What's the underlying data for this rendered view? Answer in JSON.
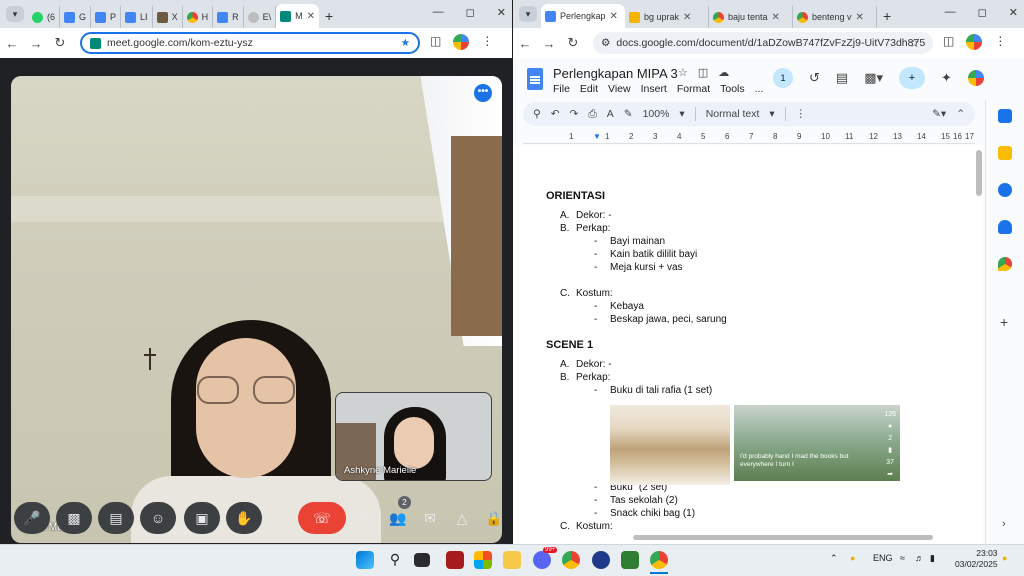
{
  "left_browser": {
    "tabs": [
      {
        "label": "(6",
        "icon": "whatsapp-icon"
      },
      {
        "label": "G",
        "icon": "doc-icon"
      },
      {
        "label": "P",
        "icon": "doc-icon"
      },
      {
        "label": "LI",
        "icon": "doc-icon"
      },
      {
        "label": "X",
        "icon": "image-icon"
      },
      {
        "label": "H",
        "icon": "chrome-icon"
      },
      {
        "label": "R",
        "icon": "doc-icon"
      },
      {
        "label": "E\\",
        "icon": "blank-icon"
      },
      {
        "label": "M",
        "icon": "meet-icon",
        "active": true
      }
    ],
    "url": "meet.google.com/kom-eztu-ysz"
  },
  "meet": {
    "main_participant": "Maria Mulia",
    "pip_participant": "Ashkyne Marielle",
    "participants_badge": "2",
    "more_options": "•••"
  },
  "right_browser": {
    "tabs": [
      {
        "label": "Perlengkap",
        "icon": "doc-icon",
        "active": true
      },
      {
        "label": "bg uprak",
        "icon": "slides-icon"
      },
      {
        "label": "baju tenta",
        "icon": "chrome-icon"
      },
      {
        "label": "benteng v",
        "icon": "chrome-icon"
      }
    ],
    "url": "docs.google.com/document/d/1aDZowB747fZvFzZj9-UitV73dh875..."
  },
  "docs": {
    "title": "Perlengkapan MIPA 3",
    "menu": [
      "File",
      "Edit",
      "View",
      "Insert",
      "Format",
      "Tools",
      "..."
    ],
    "viewers": "1",
    "zoom": "100%",
    "style": "Normal text",
    "ruler": [
      "1",
      "1",
      "2",
      "3",
      "4",
      "5",
      "6",
      "7",
      "8",
      "9",
      "10",
      "11",
      "12",
      "13",
      "14",
      "15",
      "16",
      "17"
    ],
    "orientasi": {
      "heading": "ORIENTASI",
      "a": {
        "marker": "A.",
        "text": "Dekor: -"
      },
      "b": {
        "marker": "B.",
        "text": "Perkap:"
      },
      "b_items": [
        "Bayi mainan",
        "Kain batik dililit bayi",
        "Meja kursi + vas"
      ],
      "c": {
        "marker": "C.",
        "text": "Kostum:"
      },
      "c_items": [
        "Kebaya",
        "Beskap jawa, peci, sarung"
      ]
    },
    "scene1": {
      "heading": "SCENE 1",
      "a": {
        "marker": "A.",
        "text": "Dekor: -"
      },
      "b": {
        "marker": "B.",
        "text": "Perkap:"
      },
      "b_item_first": "Buku di tali rafia (1 set)",
      "b_items_rest": [
        "Buku” (2 set)",
        "Tas sekolah (2)",
        "Snack chiki bag (1)"
      ],
      "c": {
        "marker": "C.",
        "text": "Kostum:"
      }
    },
    "image2_caption": "I'd probably hand I mad the books but everywhere I turn I",
    "image2_count_top": "126",
    "image2_count_mid": "2",
    "image2_count_bot": "37"
  },
  "taskbar": {
    "lang": "ENG",
    "time": "23:03",
    "date": "03/02/2025",
    "discord_badge": "99+"
  }
}
